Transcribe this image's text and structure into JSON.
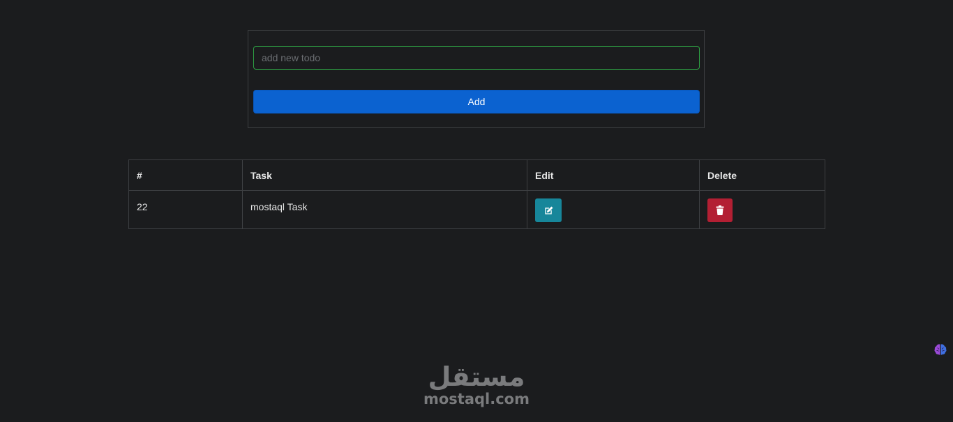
{
  "form": {
    "input_placeholder": "add new todo",
    "input_value": "",
    "add_label": "Add"
  },
  "table": {
    "headers": [
      "#",
      "Task",
      "Edit",
      "Delete"
    ],
    "rows": [
      {
        "id": "22",
        "task": "mostaql Task"
      }
    ]
  },
  "icons": {
    "edit": "edit-icon",
    "delete": "trash-icon",
    "badge": "brain-icon"
  },
  "colors": {
    "background": "#1b1c1e",
    "primary": "#0b62d0",
    "edit": "#17869a",
    "delete": "#b31f33",
    "input_border": "#2ea043"
  },
  "watermark": {
    "arabic": "مستقل",
    "latin": "mostaql.com"
  }
}
